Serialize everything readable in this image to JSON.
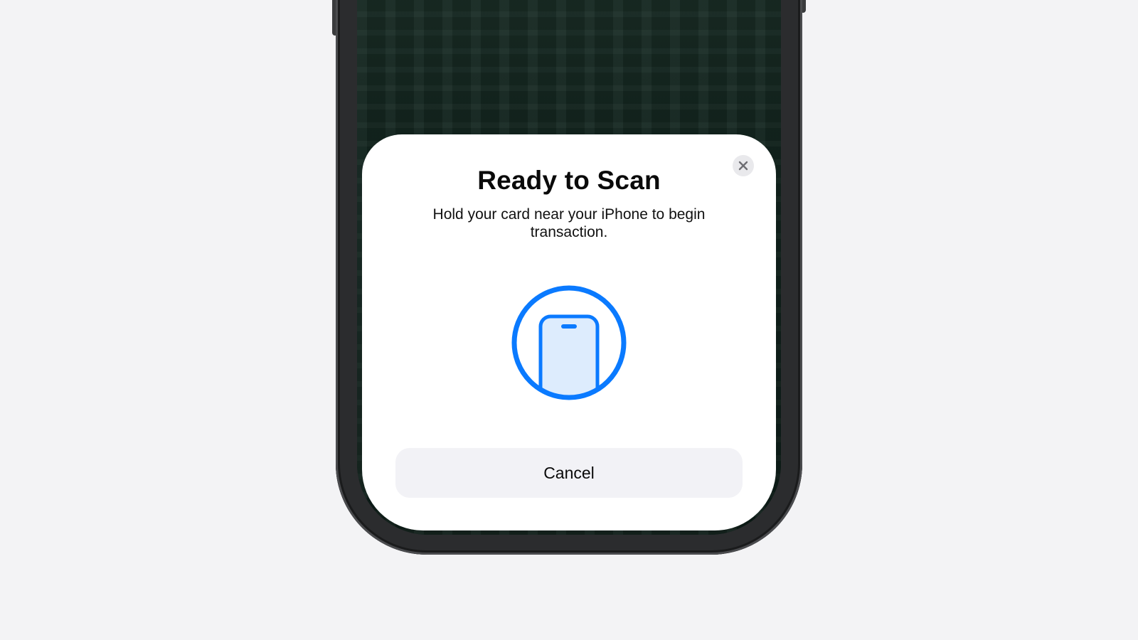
{
  "sheet": {
    "title": "Ready to Scan",
    "subtitle": "Hold your card near your iPhone to begin transaction.",
    "cancel_label": "Cancel",
    "close_icon": "xmark-icon",
    "scan_icon": "iphone-in-circle-icon"
  },
  "colors": {
    "accent": "#0a7aff",
    "accent_fill": "#ddecfd",
    "sheet_background": "#ffffff",
    "button_background": "#f2f2f6",
    "page_background": "#f3f3f5"
  }
}
